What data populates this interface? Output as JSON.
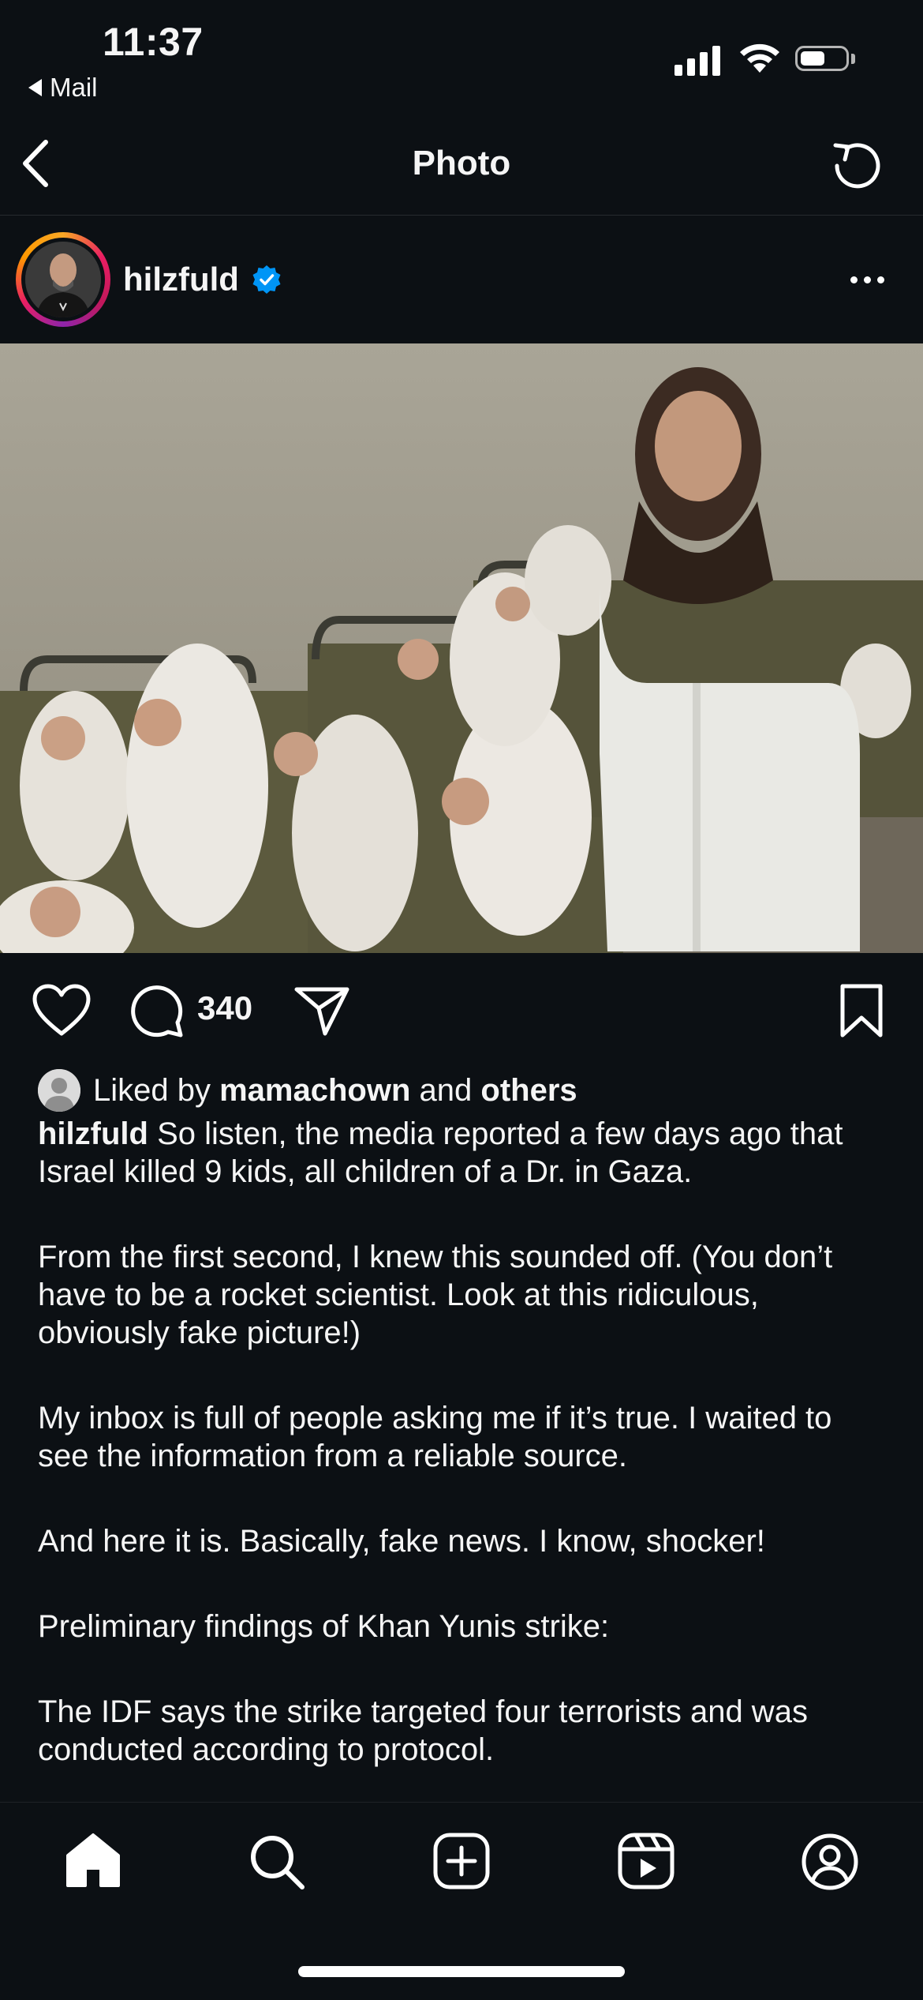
{
  "status_bar": {
    "time": "11:37",
    "back_app": "Mail"
  },
  "nav": {
    "title": "Photo"
  },
  "post": {
    "username": "hilzfuld",
    "verified": true,
    "photo_icon": "photo-image",
    "comment_count": "340",
    "liked_prefix": "Liked by",
    "liked_user": "mamachown",
    "liked_and": "and",
    "liked_others": "others",
    "caption_user": "hilzfuld",
    "caption_paragraphs": [
      "So listen, the media reported a few days ago that Israel killed 9 kids, all children of a Dr. in Gaza.",
      "From the first second, I knew this sounded off. (You don’t have to be a rocket scientist. Look at this ridiculous, obviously fake picture!)",
      "My inbox is full of people asking me if it’s true. I waited to see the information from a reliable source.",
      "And here it is. Basically, fake news. I know, shocker!",
      "Preliminary findings of Khan Yunis strike:",
      "The IDF says the strike targeted four terrorists and was conducted according to protocol."
    ]
  },
  "tabs": [
    {
      "name": "home",
      "icon": "home-icon"
    },
    {
      "name": "search",
      "icon": "search-icon"
    },
    {
      "name": "create",
      "icon": "plus-square-icon"
    },
    {
      "name": "reels",
      "icon": "reels-icon"
    },
    {
      "name": "profile",
      "icon": "profile-icon"
    }
  ],
  "colors": {
    "background": "#0c1014",
    "text": "#f5f5f5",
    "verified_blue": "#0095f6"
  }
}
